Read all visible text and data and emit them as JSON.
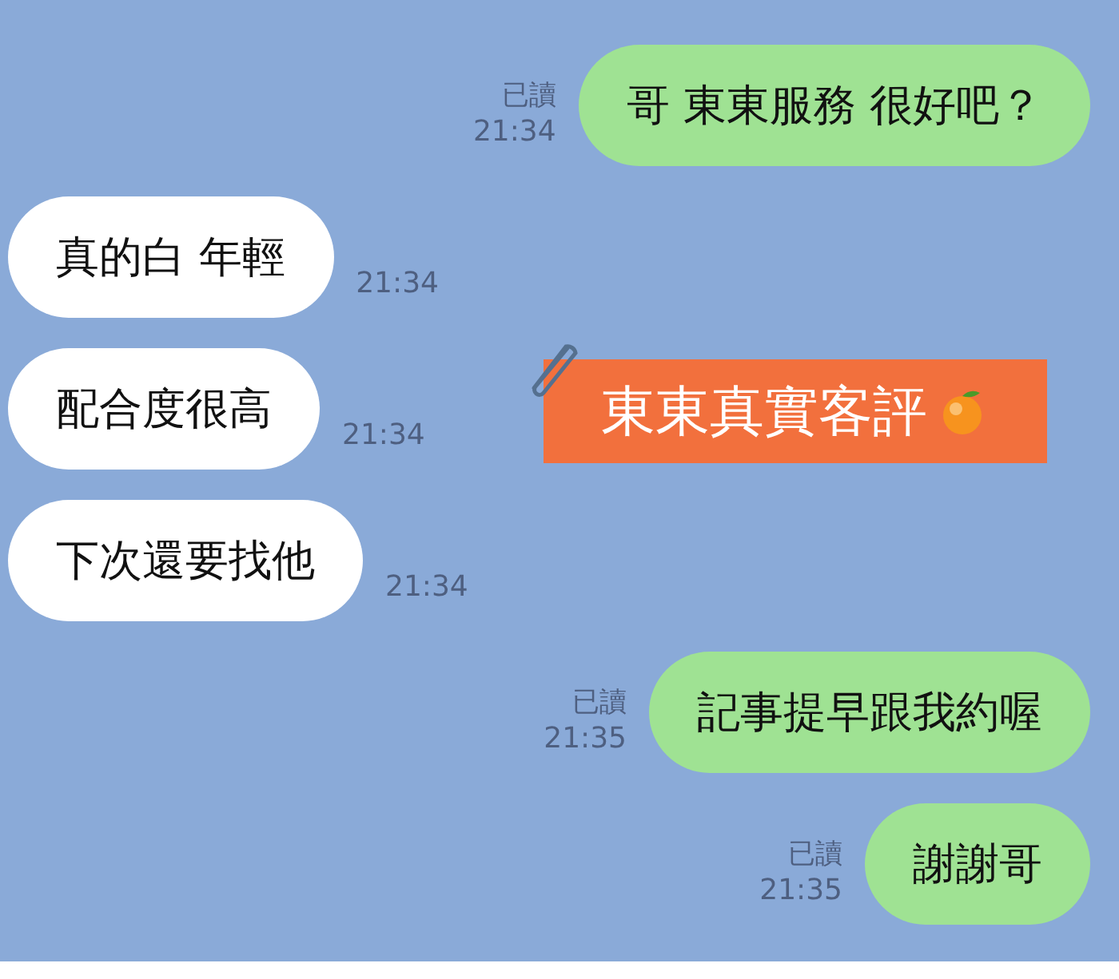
{
  "messages": [
    {
      "kind": "sent",
      "text": "哥 東東服務 很好吧？",
      "receipt": "已讀",
      "time": "21:34"
    },
    {
      "kind": "received",
      "text": "真的白 年輕",
      "time": "21:34"
    },
    {
      "kind": "received",
      "text": "配合度很高",
      "time": "21:34"
    },
    {
      "kind": "received",
      "text": "下次還要找他",
      "time": "21:34"
    },
    {
      "kind": "sent",
      "text": "記事提早跟我約喔",
      "receipt": "已讀",
      "time": "21:35"
    },
    {
      "kind": "sent",
      "text": "謝謝哥",
      "receipt": "已讀",
      "time": "21:35"
    }
  ],
  "sticker": {
    "text": "東東真實客評"
  }
}
